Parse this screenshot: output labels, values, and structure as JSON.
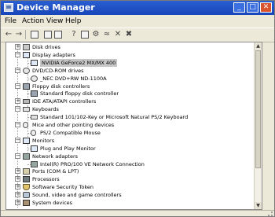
{
  "window": {
    "title": "Device Manager"
  },
  "menu": [
    "File",
    "Action",
    "View",
    "Help"
  ],
  "tree": {
    "items": [
      {
        "label": "Disk drives",
        "expander": "+",
        "icon": "drive-icon"
      },
      {
        "label": "Display adapters",
        "expander": "−",
        "icon": "monitor-icon"
      },
      {
        "label": "NVIDIA GeForce2 MX/MX 400",
        "expander": "",
        "icon": "display-adapter-icon",
        "selected": true
      },
      {
        "label": "DVD/CD-ROM drives",
        "expander": "−",
        "icon": "disc-icon"
      },
      {
        "label": "_NEC DVD+RW ND-1100A",
        "expander": "",
        "icon": "disc-icon"
      },
      {
        "label": "Floppy disk controllers",
        "expander": "−",
        "icon": "floppy-icon"
      },
      {
        "label": "Standard floppy disk controller",
        "expander": "",
        "icon": "floppy-icon"
      },
      {
        "label": "IDE ATA/ATAPI controllers",
        "expander": "+",
        "icon": "ide-icon"
      },
      {
        "label": "Keyboards",
        "expander": "−",
        "icon": "keyboard-icon"
      },
      {
        "label": "Standard 101/102-Key or Microsoft Natural PS/2 Keyboard",
        "expander": "",
        "icon": "keyboard-icon"
      },
      {
        "label": "Mice and other pointing devices",
        "expander": "−",
        "icon": "mouse-icon"
      },
      {
        "label": "PS/2 Compatible Mouse",
        "expander": "",
        "icon": "mouse-icon"
      },
      {
        "label": "Monitors",
        "expander": "−",
        "icon": "monitor-icon"
      },
      {
        "label": "Plug and Play Monitor",
        "expander": "",
        "icon": "monitor-icon"
      },
      {
        "label": "Network adapters",
        "expander": "−",
        "icon": "network-icon"
      },
      {
        "label": "Intel(R) PRO/100 VE Network Connection",
        "expander": "",
        "icon": "network-icon"
      },
      {
        "label": "Ports (COM & LPT)",
        "expander": "+",
        "icon": "port-icon"
      },
      {
        "label": "Processors",
        "expander": "+",
        "icon": "cpu-icon"
      },
      {
        "label": "Software Security Token",
        "expander": "+",
        "icon": "shield-icon"
      },
      {
        "label": "Sound, video and game controllers",
        "expander": "+",
        "icon": "speaker-icon"
      },
      {
        "label": "System devices",
        "expander": "+",
        "icon": "chip-icon"
      }
    ]
  },
  "colors": {
    "titlebar": "#1f4fc2",
    "selection": "#c6c6c6",
    "chrome": "#ece9d8"
  }
}
